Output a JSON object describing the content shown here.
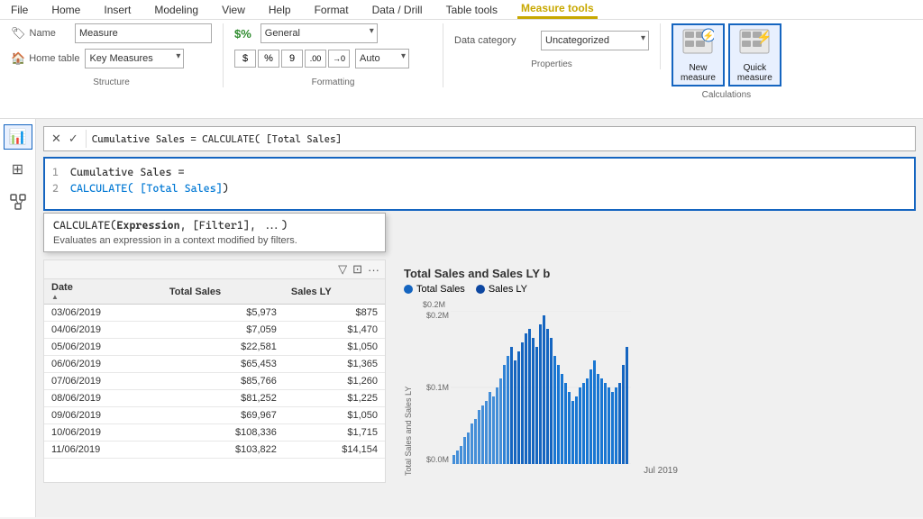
{
  "menu": {
    "items": [
      "File",
      "Home",
      "Insert",
      "Modeling",
      "View",
      "Help",
      "Format",
      "Data / Drill",
      "Table tools",
      "Measure tools"
    ],
    "active": "Measure tools"
  },
  "ribbon": {
    "structure_group": {
      "label": "Structure",
      "name_label": "Name",
      "name_value": "Measure",
      "home_table_label": "Home table",
      "home_table_value": "Key Measures"
    },
    "formatting_group": {
      "label": "Formatting",
      "format_icon": "$%",
      "format_value": "General",
      "currency_symbol": "$",
      "percent_symbol": "%",
      "comma_symbol": "9",
      "decimal_inc": ".00",
      "decimal_dec": "→0",
      "auto_label": "Auto"
    },
    "properties_group": {
      "label": "Properties",
      "data_category_label": "Data category",
      "data_category_value": "Uncategorized"
    },
    "calculations_group": {
      "label": "Calculations",
      "new_measure_label": "New\nmeasure",
      "quick_measure_label": "Quick\nmeasure"
    }
  },
  "formula_bar": {
    "cancel_symbol": "✕",
    "confirm_symbol": "✓"
  },
  "code_editor": {
    "line1_num": "1",
    "line1_text": "Cumulative Sales =",
    "line2_num": "2",
    "line2_function": "CALCULATE(",
    "line2_var": "[Total Sales]",
    "line2_close": ")"
  },
  "autocomplete": {
    "signature": "CALCULATE(Expression, [Filter1], ...)",
    "bold_part": "Expression",
    "description": "Evaluates an expression in a context modified by filters."
  },
  "toolbar": {
    "items": [
      "📊",
      "⊞",
      "📋"
    ]
  },
  "table": {
    "toolbar_icons": [
      "▽",
      "⊡",
      "···"
    ],
    "columns": [
      "Date",
      "Total Sales",
      "Sales LY"
    ],
    "sort_col": "Date",
    "rows": [
      [
        "03/06/2019",
        "$5,973",
        "$875"
      ],
      [
        "04/06/2019",
        "$7,059",
        "$1,470"
      ],
      [
        "05/06/2019",
        "$22,581",
        "$1,050"
      ],
      [
        "06/06/2019",
        "$65,453",
        "$1,365"
      ],
      [
        "07/06/2019",
        "$85,766",
        "$1,260"
      ],
      [
        "08/06/2019",
        "$81,252",
        "$1,225"
      ],
      [
        "09/06/2019",
        "$69,967",
        "$1,050"
      ],
      [
        "10/06/2019",
        "$108,336",
        "$1,715"
      ],
      [
        "11/06/2019",
        "$103,822",
        "$14,154"
      ]
    ]
  },
  "chart": {
    "title": "Total Sales and Sales LY b",
    "legend": [
      {
        "label": "Total Sales",
        "color": "#1565c0"
      },
      {
        "label": "Sales LY",
        "color": "#1565c0"
      }
    ],
    "y_label": "Total Sales and Sales LY",
    "x_label": "Jul 2019",
    "y_ticks": [
      "$0.2M",
      "$0.1M",
      "$0.0M"
    ]
  }
}
